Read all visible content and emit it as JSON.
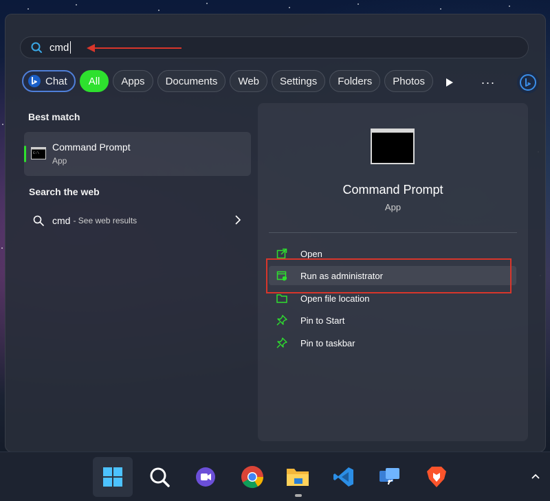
{
  "search": {
    "query": "cmd"
  },
  "filters": [
    {
      "label": "Chat",
      "name": "filter-chat"
    },
    {
      "label": "All",
      "name": "filter-all"
    },
    {
      "label": "Apps",
      "name": "filter-apps"
    },
    {
      "label": "Documents",
      "name": "filter-documents"
    },
    {
      "label": "Web",
      "name": "filter-web"
    },
    {
      "label": "Settings",
      "name": "filter-settings"
    },
    {
      "label": "Folders",
      "name": "filter-folders"
    },
    {
      "label": "Photos",
      "name": "filter-photos"
    }
  ],
  "more_label": "···",
  "left": {
    "best_match_title": "Best match",
    "best_match": {
      "name": "Command Prompt",
      "kind": "App"
    },
    "web_title": "Search the web",
    "web_result": {
      "term": "cmd",
      "hint": "- See web results"
    }
  },
  "detail": {
    "title": "Command Prompt",
    "subtitle": "App",
    "actions": [
      {
        "label": "Open",
        "icon": "open-external-icon"
      },
      {
        "label": "Run as administrator",
        "icon": "shield-admin-icon"
      },
      {
        "label": "Open file location",
        "icon": "folder-icon"
      },
      {
        "label": "Pin to Start",
        "icon": "pin-icon"
      },
      {
        "label": "Pin to taskbar",
        "icon": "pin-icon"
      }
    ]
  },
  "taskbar": {
    "apps": [
      "start",
      "search",
      "meet",
      "chrome",
      "file-explorer",
      "vscode",
      "cast",
      "brave"
    ]
  },
  "colors": {
    "accent_green": "#2ee02e",
    "annotation_red": "#d9362b",
    "chat_blue": "#4f7fd9"
  }
}
